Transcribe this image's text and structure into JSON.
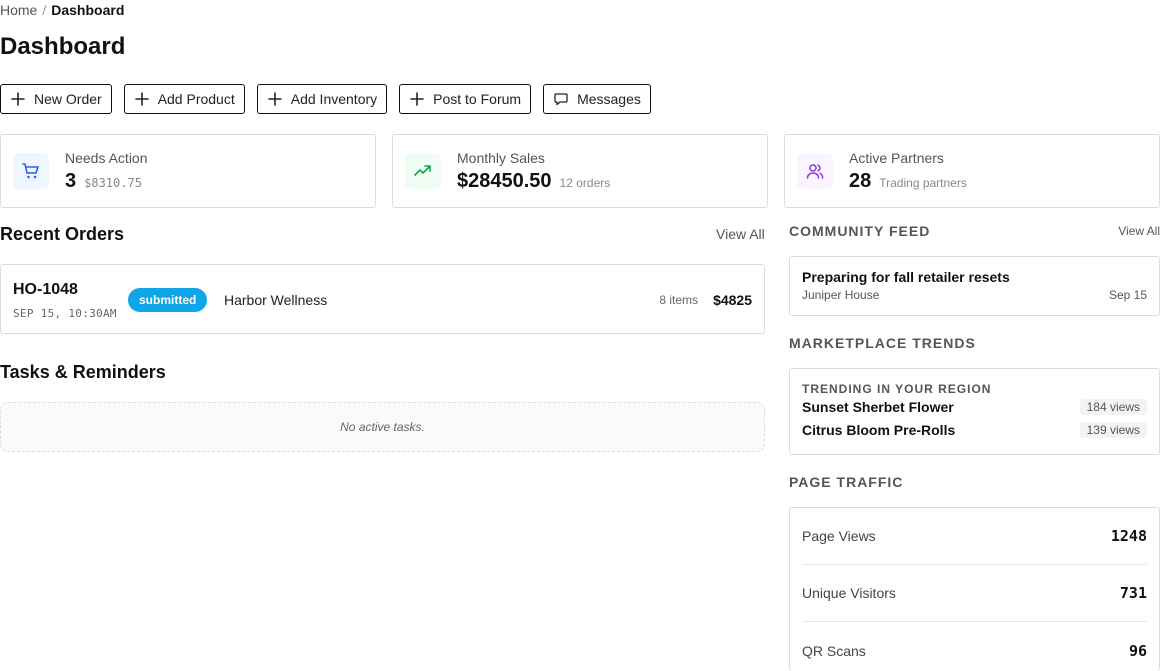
{
  "breadcrumb": {
    "home": "Home",
    "separator": "/",
    "current": "Dashboard"
  },
  "page": {
    "title": "Dashboard"
  },
  "actions": [
    {
      "label": "New Order",
      "icon": "plus-icon"
    },
    {
      "label": "Add Product",
      "icon": "plus-icon"
    },
    {
      "label": "Add Inventory",
      "icon": "plus-icon"
    },
    {
      "label": "Post to Forum",
      "icon": "plus-icon"
    },
    {
      "label": "Messages",
      "icon": "message-icon"
    }
  ],
  "stats": [
    {
      "label": "Needs Action",
      "value": "3",
      "sub": "$8310.75",
      "icon": "cart-icon",
      "color": "#2563eb",
      "bg": "#eff6ff"
    },
    {
      "label": "Monthly Sales",
      "value": "$28450.50",
      "sub": "12 orders",
      "icon": "trending-up-icon",
      "color": "#16a34a",
      "bg": "#f0fdf4"
    },
    {
      "label": "Active Partners",
      "value": "28",
      "sub": "Trading partners",
      "icon": "users-icon",
      "color": "#9333ea",
      "bg": "#faf5ff"
    }
  ],
  "recent_orders": {
    "title": "Recent Orders",
    "view_all": "View All",
    "orders": [
      {
        "id": "HO-1048",
        "date": "SEP 15, 10:30AM",
        "status": "submitted",
        "status_color": "#0ea5e9",
        "customer": "Harbor Wellness",
        "items": "8 items",
        "total": "$4825"
      }
    ]
  },
  "tasks": {
    "title": "Tasks & Reminders",
    "empty": "No active tasks."
  },
  "community_feed": {
    "title": "COMMUNITY FEED",
    "view_all": "View All",
    "posts": [
      {
        "title": "Preparing for fall retailer resets",
        "author": "Juniper House",
        "date": "Sep 15"
      }
    ]
  },
  "marketplace_trends": {
    "title": "MARKETPLACE TRENDS",
    "heading": "TRENDING IN YOUR REGION",
    "items": [
      {
        "name": "Sunset Sherbet Flower",
        "views": "184 views"
      },
      {
        "name": "Citrus Bloom Pre-Rolls",
        "views": "139 views"
      }
    ]
  },
  "page_traffic": {
    "title": "PAGE TRAFFIC",
    "metrics": [
      {
        "label": "Page Views",
        "value": "1248"
      },
      {
        "label": "Unique Visitors",
        "value": "731"
      },
      {
        "label": "QR Scans",
        "value": "96"
      }
    ]
  }
}
